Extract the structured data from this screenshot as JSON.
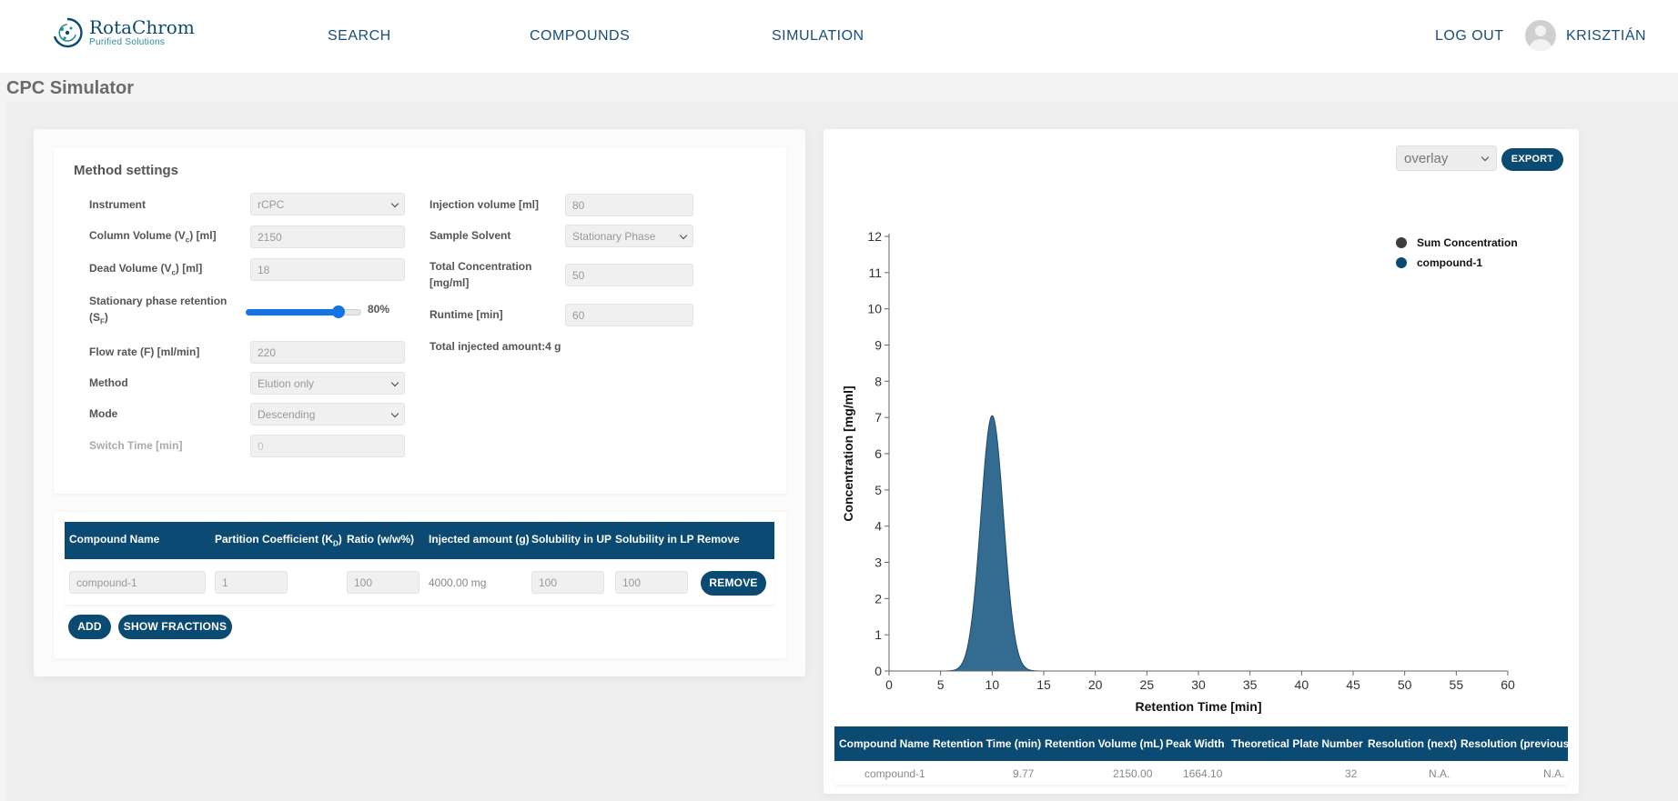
{
  "nav": {
    "brand_name": "RotaChrom",
    "brand_tagline": "Purified Solutions",
    "links": [
      "SEARCH",
      "COMPOUNDS",
      "SIMULATION"
    ],
    "logout": "LOG OUT",
    "user": "KRISZTIÁN"
  },
  "page": {
    "title": "CPC Simulator"
  },
  "method_settings": {
    "title": "Method settings",
    "instrument": {
      "label": "Instrument",
      "value": "rCPC"
    },
    "column_volume": {
      "label_pre": "Column Volume (V",
      "sub": "c",
      "label_post": ") [ml]",
      "value": "2150"
    },
    "dead_volume": {
      "label_pre": "Dead Volume (V",
      "sub": "c",
      "label_post": ") [ml]",
      "value": "18"
    },
    "stationary_retention": {
      "label_line1": "Stationary phase retention",
      "label_pre": "(S",
      "sub": "F",
      "label_post": ")",
      "value": 80,
      "value_text": "80%"
    },
    "flow_rate": {
      "label": "Flow rate (F) [ml/min]",
      "value": "220"
    },
    "method": {
      "label": "Method",
      "value": "Elution only"
    },
    "mode": {
      "label": "Mode",
      "value": "Descending"
    },
    "switch_time": {
      "label": "Switch Time [min]",
      "value": "0"
    },
    "injection_volume": {
      "label": "Injection volume [ml]",
      "value": "80"
    },
    "sample_solvent": {
      "label": "Sample Solvent",
      "value": "Stationary Phase"
    },
    "total_concentration": {
      "label_line1": "Total Concentration",
      "label_line2": "[mg/ml]",
      "value": "50"
    },
    "runtime": {
      "label": "Runtime [min]",
      "value": "60"
    },
    "total_injected": "Total injected amount:4 g"
  },
  "compounds_table": {
    "headers": {
      "name": "Compound Name",
      "kd_pre": "Partition Coefficient (K",
      "kd_sub": "D",
      "kd_post": ")",
      "ratio": "Ratio (w/w%)",
      "injected": "Injected amount (g)",
      "sol_up": "Solubility in UP",
      "sol_lp": "Solubility in LP",
      "remove": "Remove"
    },
    "row": {
      "name": "compound-1",
      "kd": "1",
      "ratio": "100",
      "injected": "4000.00 mg",
      "sol_up": "100",
      "sol_lp": "100",
      "remove_btn": "REMOVE"
    },
    "add_btn": "ADD",
    "fractions_btn": "SHOW FRACTIONS"
  },
  "chart_panel": {
    "view_select": "overlay",
    "export_btn": "EXPORT"
  },
  "chart_data": {
    "type": "area",
    "xlabel": "Retention Time [min]",
    "ylabel": "Concentration [mg/ml]",
    "xlim": [
      0,
      60
    ],
    "ylim": [
      0,
      12
    ],
    "x_ticks": [
      0,
      5,
      10,
      15,
      20,
      25,
      30,
      35,
      40,
      45,
      50,
      55,
      60
    ],
    "y_ticks": [
      0,
      1,
      2,
      3,
      4,
      5,
      6,
      7,
      8,
      9,
      10,
      11,
      12
    ],
    "legend_position": "top-right",
    "series": [
      {
        "name": "Sum Concentration",
        "color": "#3d3d3d",
        "peak_x": 10,
        "peak_y": 7.05,
        "sigma": 1.1
      },
      {
        "name": "compound-1",
        "color": "#0b4a72",
        "peak_x": 10,
        "peak_y": 7.05,
        "sigma": 1.1
      }
    ]
  },
  "results_table": {
    "headers": [
      "Compound Name",
      "Retention Time (min)",
      "Retention Volume (mL)",
      "Peak Width",
      "Theoretical Plate Number",
      "Resolution (next)",
      "Resolution (previous)"
    ],
    "rows": [
      [
        "compound-1",
        "9.77",
        "2150.00",
        "1664.10",
        "32",
        "N.A.",
        "N.A."
      ]
    ]
  }
}
